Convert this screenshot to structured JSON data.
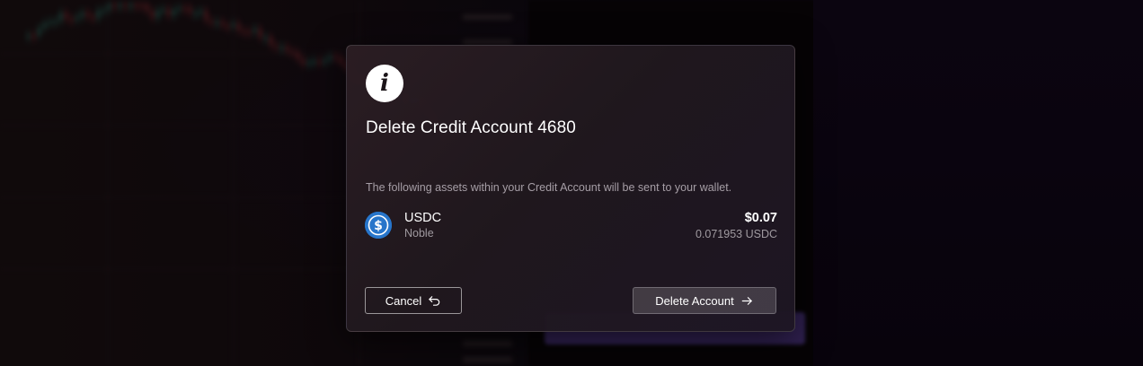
{
  "modal": {
    "icon": "info-icon",
    "title": "Delete Credit Account 4680",
    "description": "The following assets within your Credit Account will be sent to your wallet.",
    "assets": [
      {
        "icon": "usdc-icon",
        "symbol": "USDC",
        "chain": "Noble",
        "value": "$0.07",
        "amount": "0.071953 USDC"
      }
    ],
    "cancel_label": "Cancel",
    "delete_label": "Delete Account"
  },
  "colors": {
    "usdc_brand": "#2775ca",
    "modal_bg": "#2a1f26",
    "muted_text": "#a69ea6"
  }
}
